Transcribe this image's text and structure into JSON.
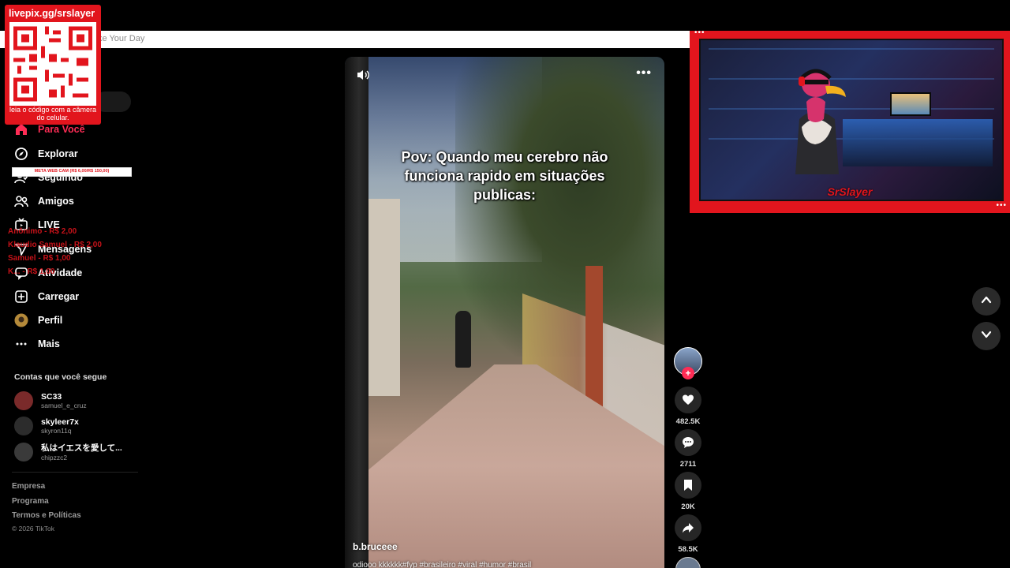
{
  "topbar": {
    "hint": "ke Your Day"
  },
  "qr": {
    "title": "livepix.gg/srslayer",
    "caption": "leia o código com a câmera do celular."
  },
  "sidebar": {
    "items": [
      {
        "label": "Para Você",
        "icon": "home-icon"
      },
      {
        "label": "Explorar",
        "icon": "compass-icon"
      },
      {
        "label": "Seguindo",
        "icon": "following-icon"
      },
      {
        "label": "Amigos",
        "icon": "friends-icon"
      },
      {
        "label": "LIVE",
        "icon": "live-tv-icon"
      },
      {
        "label": "Mensagens",
        "icon": "send-icon"
      },
      {
        "label": "Atividade",
        "icon": "message-icon"
      },
      {
        "label": "Carregar",
        "icon": "upload-icon"
      },
      {
        "label": "Perfil",
        "icon": "profile-avatar"
      },
      {
        "label": "Mais",
        "icon": "more-icon"
      }
    ],
    "goal_bar": "META WEB CAM (R$ 6,00/R$ 150,00)",
    "donations": [
      "Anônimo - R$ 2,00",
      "Klaudio Samuel - R$ 2,00",
      "Samuel - R$ 1,00",
      "K... - R$ 1,00"
    ],
    "following_title": "Contas que você segue",
    "accounts": [
      {
        "name": "SC33",
        "handle": "samuel_e_cruz"
      },
      {
        "name": "skyleer7x",
        "handle": "skyron11q"
      },
      {
        "name": "私はイエスを愛して...",
        "handle": "chipzzc2"
      }
    ],
    "footer": [
      "Empresa",
      "Programa",
      "Termos e Políticas"
    ],
    "copyright": "© 2026 TikTok"
  },
  "video": {
    "caption": "Pov: Quando meu cerebro não funciona rapido em situações publicas:",
    "username": "b.bruceee",
    "description": "odiooo kkkkkk#fyp #brasileiro #viral #humor #brasil"
  },
  "actions": {
    "likes": "482.5K",
    "comments": "2711",
    "saves": "20K",
    "shares": "58.5K"
  },
  "webcam": {
    "name": "SrSlayer"
  },
  "colors": {
    "accent": "#fe2c55",
    "overlay_red": "#e2151d"
  }
}
